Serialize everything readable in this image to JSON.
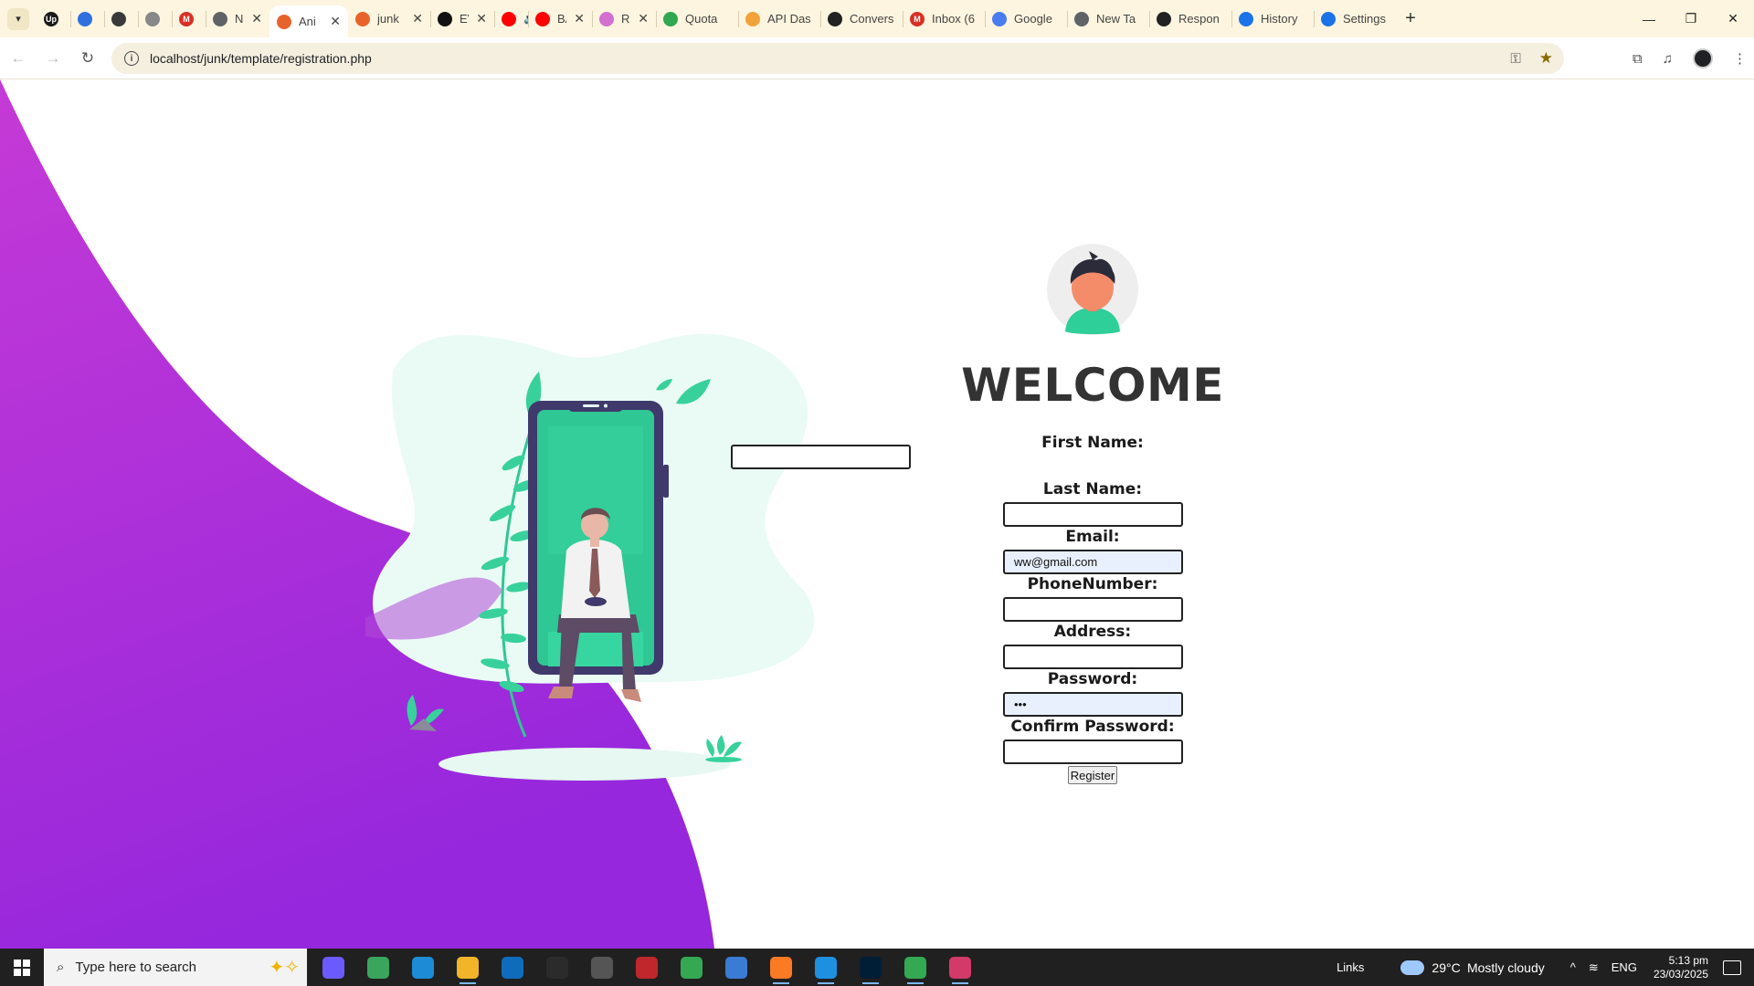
{
  "browser": {
    "tabs": [
      {
        "label": "",
        "fav_color": "#1a1a1a",
        "fav_glyph": "Up",
        "closable": false
      },
      {
        "label": "",
        "fav_color": "#2f6fe0",
        "fav_glyph": "",
        "closable": false
      },
      {
        "label": "",
        "fav_color": "#3a3a3a",
        "fav_glyph": "",
        "closable": false
      },
      {
        "label": "",
        "fav_color": "#888888",
        "fav_glyph": "",
        "closable": false
      },
      {
        "label": "",
        "fav_color": "#d93025",
        "fav_glyph": "M",
        "closable": false
      },
      {
        "label": "Ne",
        "fav_color": "#5f6368",
        "fav_glyph": "",
        "closable": true
      },
      {
        "label": "Ani",
        "fav_color": "#e8632b",
        "fav_glyph": "",
        "closable": true,
        "active": true
      },
      {
        "label": "junk",
        "fav_color": "#e8632b",
        "fav_glyph": "",
        "closable": true
      },
      {
        "label": "EV",
        "fav_color": "#111111",
        "fav_glyph": "",
        "closable": true
      },
      {
        "label": "",
        "fav_color": "#ff0000",
        "fav_glyph": "",
        "closable": true,
        "audio": true
      },
      {
        "label": "BA",
        "fav_color": "#ff0000",
        "fav_glyph": "",
        "closable": true
      },
      {
        "label": "Rev",
        "fav_color": "#d36fd1",
        "fav_glyph": "",
        "closable": true
      },
      {
        "label": "Quota",
        "fav_color": "#2fa84f",
        "fav_glyph": "",
        "closable": false
      },
      {
        "label": "API Das",
        "fav_color": "#f2a23a",
        "fav_glyph": "",
        "closable": false
      },
      {
        "label": "Convers",
        "fav_color": "#222222",
        "fav_glyph": "",
        "closable": false
      },
      {
        "label": "Inbox (6",
        "fav_color": "#d93025",
        "fav_glyph": "M",
        "closable": false
      },
      {
        "label": "Google",
        "fav_color": "#4a7cf0",
        "fav_glyph": "",
        "closable": false
      },
      {
        "label": "New Ta",
        "fav_color": "#5f6368",
        "fav_glyph": "",
        "closable": false
      },
      {
        "label": "Respon",
        "fav_color": "#222222",
        "fav_glyph": "",
        "closable": false
      },
      {
        "label": "History",
        "fav_color": "#1a73e8",
        "fav_glyph": "",
        "closable": false
      },
      {
        "label": "Settings",
        "fav_color": "#1a73e8",
        "fav_glyph": "",
        "closable": false
      }
    ],
    "url": "localhost/junk/template/registration.php"
  },
  "form": {
    "welcome": "WELCOME",
    "first_name_label": "First Name:",
    "first_name_value": "",
    "last_name_label": "Last Name:",
    "last_name_value": "",
    "email_label": "Email:",
    "email_value": "ww@gmail.com",
    "phone_label": "PhoneNumber:",
    "phone_value": "",
    "address_label": "Address:",
    "address_value": "",
    "password_label": "Password:",
    "password_value": "•••",
    "confirm_password_label": "Confirm Password:",
    "confirm_password_value": "",
    "register_button": "Register"
  },
  "colors": {
    "wave_top": "#c038d4",
    "wave_bottom": "#9a2ad8",
    "accent_green": "#2fd39a",
    "blob": "#eafbf5"
  },
  "taskbar": {
    "search_placeholder": "Type here to search",
    "links": "Links",
    "temperature": "29°C",
    "weather": "Mostly cloudy",
    "language": "ENG",
    "time": "5:13 pm",
    "date": "23/03/2025",
    "apps": [
      {
        "name": "copilot-icon",
        "color": "#6b5bff",
        "open": false
      },
      {
        "name": "notepad-icon",
        "color": "#3aa55c",
        "open": false
      },
      {
        "name": "edge-icon",
        "color": "#1e8bd6",
        "open": false
      },
      {
        "name": "file-explorer-icon",
        "color": "#f2b428",
        "open": true
      },
      {
        "name": "outlook-icon",
        "color": "#0f6cbd",
        "open": false
      },
      {
        "name": "terminal-icon",
        "color": "#2b2b2b",
        "open": false
      },
      {
        "name": "git-icon",
        "color": "#555555",
        "open": false
      },
      {
        "name": "filezilla-icon",
        "color": "#c0272d",
        "open": false
      },
      {
        "name": "chrome-icon",
        "color": "#34a853",
        "open": false
      },
      {
        "name": "store-icon",
        "color": "#3a7bd5",
        "open": false
      },
      {
        "name": "xampp-icon",
        "color": "#fb7a24",
        "open": true
      },
      {
        "name": "vscode-icon",
        "color": "#1e90e0",
        "open": true
      },
      {
        "name": "photoshop-icon",
        "color": "#001e36",
        "open": true
      },
      {
        "name": "chrome-profile-icon",
        "color": "#34a853",
        "open": true
      },
      {
        "name": "snipping-tool-icon",
        "color": "#d33a6a",
        "open": true
      }
    ]
  }
}
